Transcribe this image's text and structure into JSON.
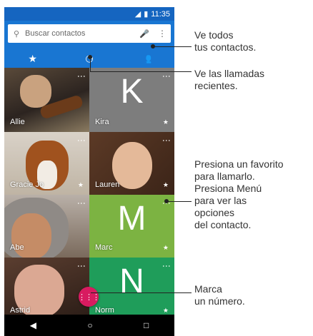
{
  "status": {
    "time": "11:35"
  },
  "search": {
    "placeholder": "Buscar contactos"
  },
  "tabs": [
    {
      "icon": "star-icon",
      "active": true
    },
    {
      "icon": "clock-icon",
      "active": false
    },
    {
      "icon": "people-icon",
      "active": false
    }
  ],
  "contacts": [
    {
      "name": "Allie",
      "kind": "photo"
    },
    {
      "name": "Kira",
      "kind": "letter",
      "letter": "K",
      "color": "#7d7d7d"
    },
    {
      "name": "Gracie Jo",
      "kind": "photo"
    },
    {
      "name": "Lauren",
      "kind": "photo"
    },
    {
      "name": "Abe",
      "kind": "photo"
    },
    {
      "name": "Marc",
      "kind": "letter",
      "letter": "M",
      "color": "#7cb342"
    },
    {
      "name": "Astrid",
      "kind": "photo"
    },
    {
      "name": "Norm",
      "kind": "letter",
      "letter": "N",
      "color": "#1f9d5a"
    }
  ],
  "callouts": {
    "all_contacts": [
      "Ve todos",
      "tus contactos."
    ],
    "recent_calls": [
      "Ve las llamadas",
      "recientes."
    ],
    "favorite": [
      "Presiona un favorito",
      "para llamarlo.",
      "Presiona Menú",
      "para ver las",
      "opciones",
      "del contacto."
    ],
    "dial": [
      "Marca",
      "un número."
    ]
  },
  "colors": {
    "accent": "#1976d2",
    "fab": "#d81b60"
  }
}
